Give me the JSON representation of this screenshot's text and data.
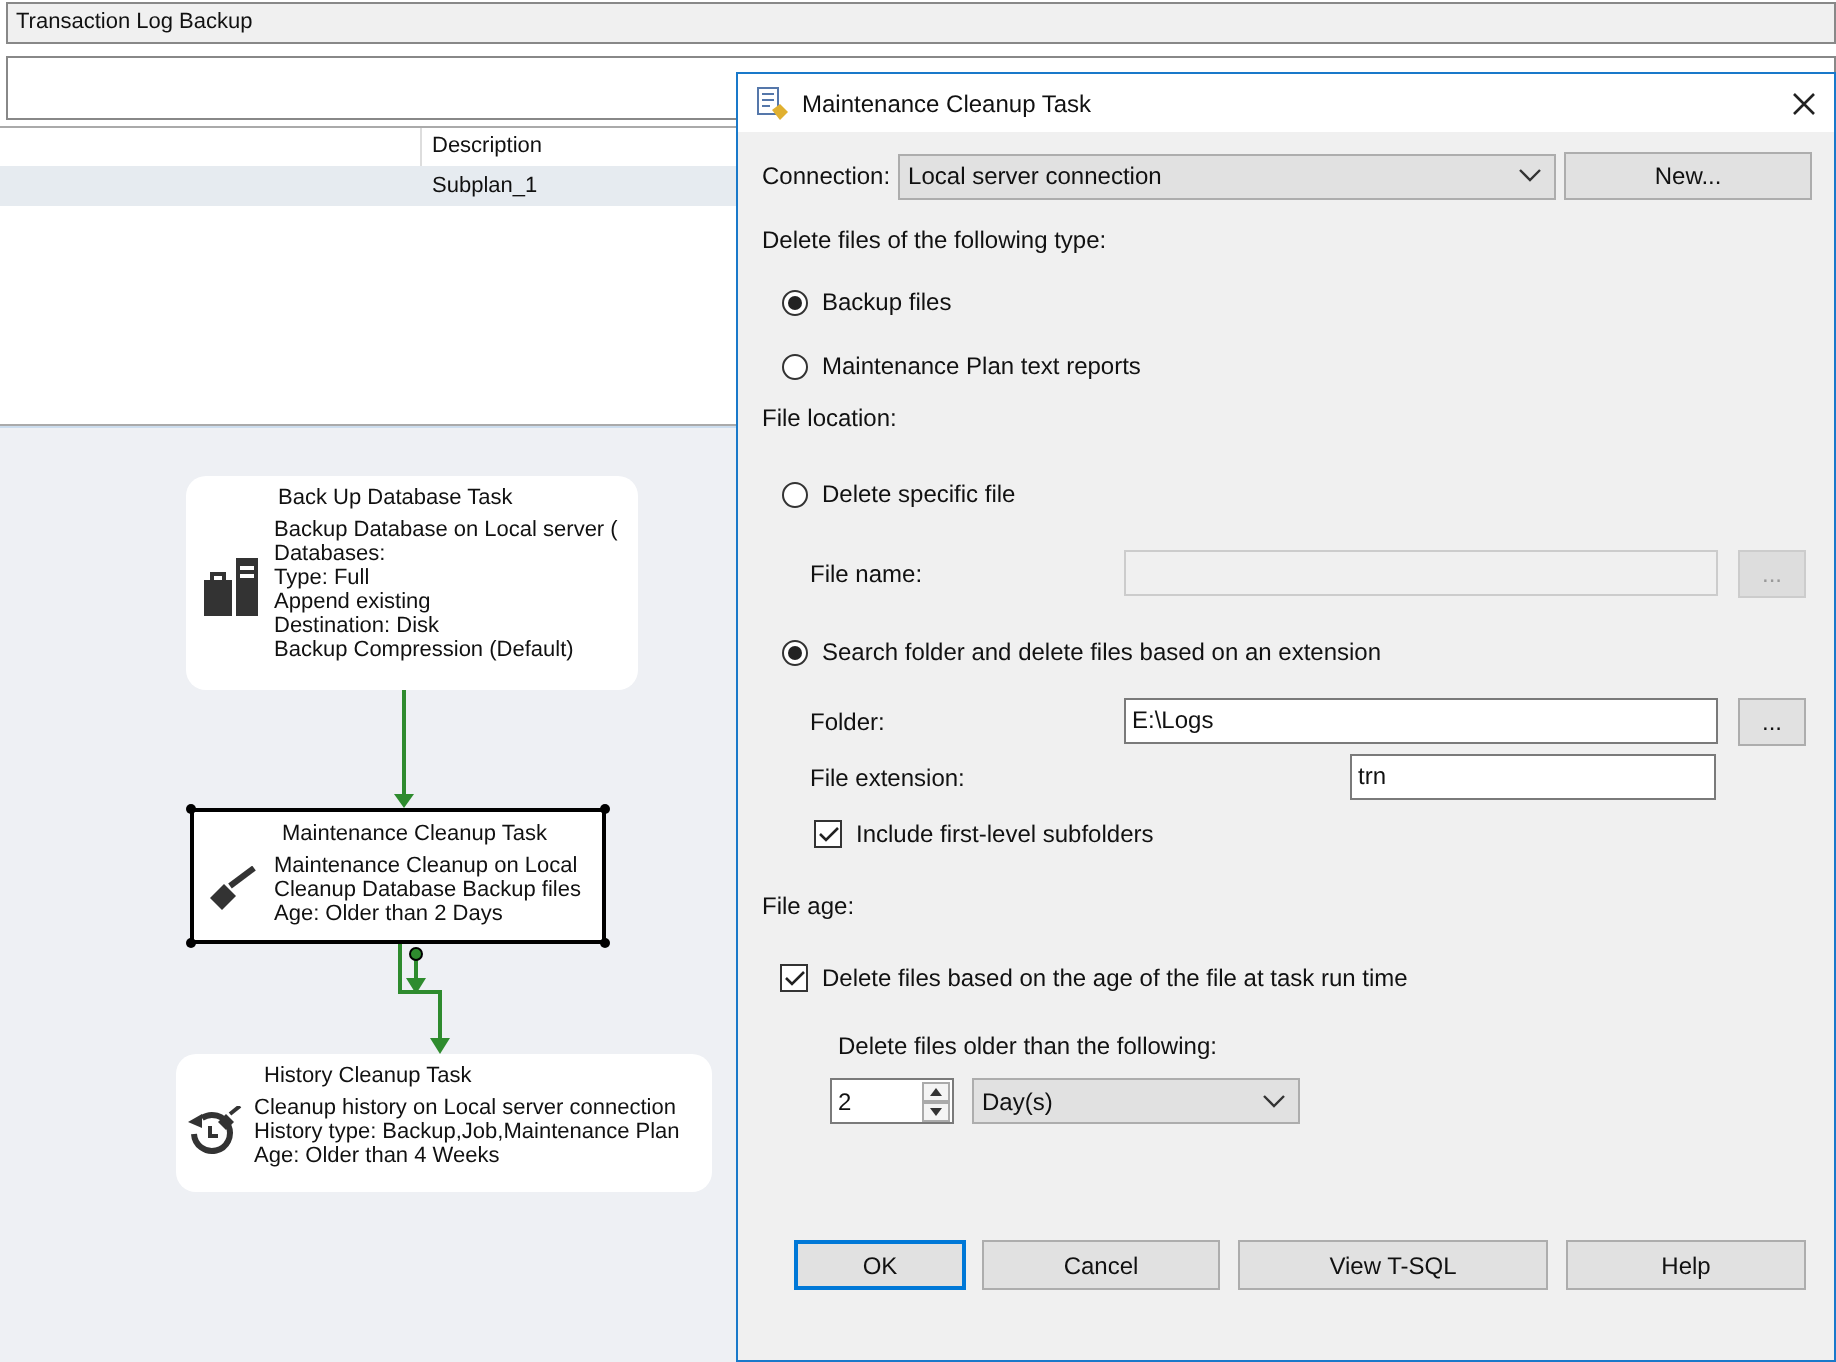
{
  "plan": {
    "name_field": {
      "value": "Transaction Log Backup"
    }
  },
  "subplans": {
    "columns": [
      "Description"
    ],
    "rows": [
      {
        "description": "Subplan_1",
        "selected": true
      }
    ]
  },
  "designer": {
    "tasks": [
      {
        "kind": "backup",
        "title": "Back Up Database Task",
        "selected": false,
        "lines": [
          "Backup Database on Local server (",
          "Databases:",
          "Type: Full",
          "Append existing",
          "Destination: Disk",
          "Backup Compression (Default)"
        ]
      },
      {
        "kind": "cleanup",
        "title": "Maintenance Cleanup Task",
        "selected": true,
        "lines": [
          "Maintenance Cleanup on Local",
          "Cleanup Database Backup files",
          "Age: Older than 2 Days"
        ]
      },
      {
        "kind": "history",
        "title": "History Cleanup Task",
        "selected": false,
        "lines": [
          "Cleanup history on Local server connection",
          "History type: Backup,Job,Maintenance Plan",
          "Age: Older than 4 Weeks"
        ]
      }
    ]
  },
  "dialog": {
    "title": "Maintenance Cleanup Task",
    "connection": {
      "label": "Connection:",
      "value": "Local server connection",
      "new_button": "New..."
    },
    "file_type": {
      "label": "Delete files of the following type:",
      "options": [
        {
          "label": "Backup files",
          "selected": true
        },
        {
          "label": "Maintenance Plan text reports",
          "selected": false
        }
      ]
    },
    "file_location": {
      "label": "File location:",
      "specific": {
        "label": "Delete specific file",
        "selected": false
      },
      "file_name": {
        "label": "File name:",
        "disabled": true,
        "browse": "..."
      },
      "search": {
        "label": "Search folder and delete files based on an extension",
        "selected": true
      },
      "folder": {
        "label": "Folder:",
        "value": "E:\\Logs",
        "browse": "..."
      },
      "extension": {
        "label": "File extension:",
        "value": "trn"
      },
      "include_subfolders": {
        "label": "Include first-level subfolders",
        "checked": true
      }
    },
    "file_age": {
      "label": "File age:",
      "by_age": {
        "label": "Delete files based on the age of the file at task run time",
        "checked": true
      },
      "older_than": {
        "label": "Delete files older than the following:",
        "amount": "2",
        "unit": "Day(s)"
      }
    },
    "buttons": [
      {
        "label": "OK",
        "default": true
      },
      {
        "label": "Cancel",
        "default": false
      },
      {
        "label": "View T-SQL",
        "default": false
      },
      {
        "label": "Help",
        "default": false
      }
    ]
  }
}
